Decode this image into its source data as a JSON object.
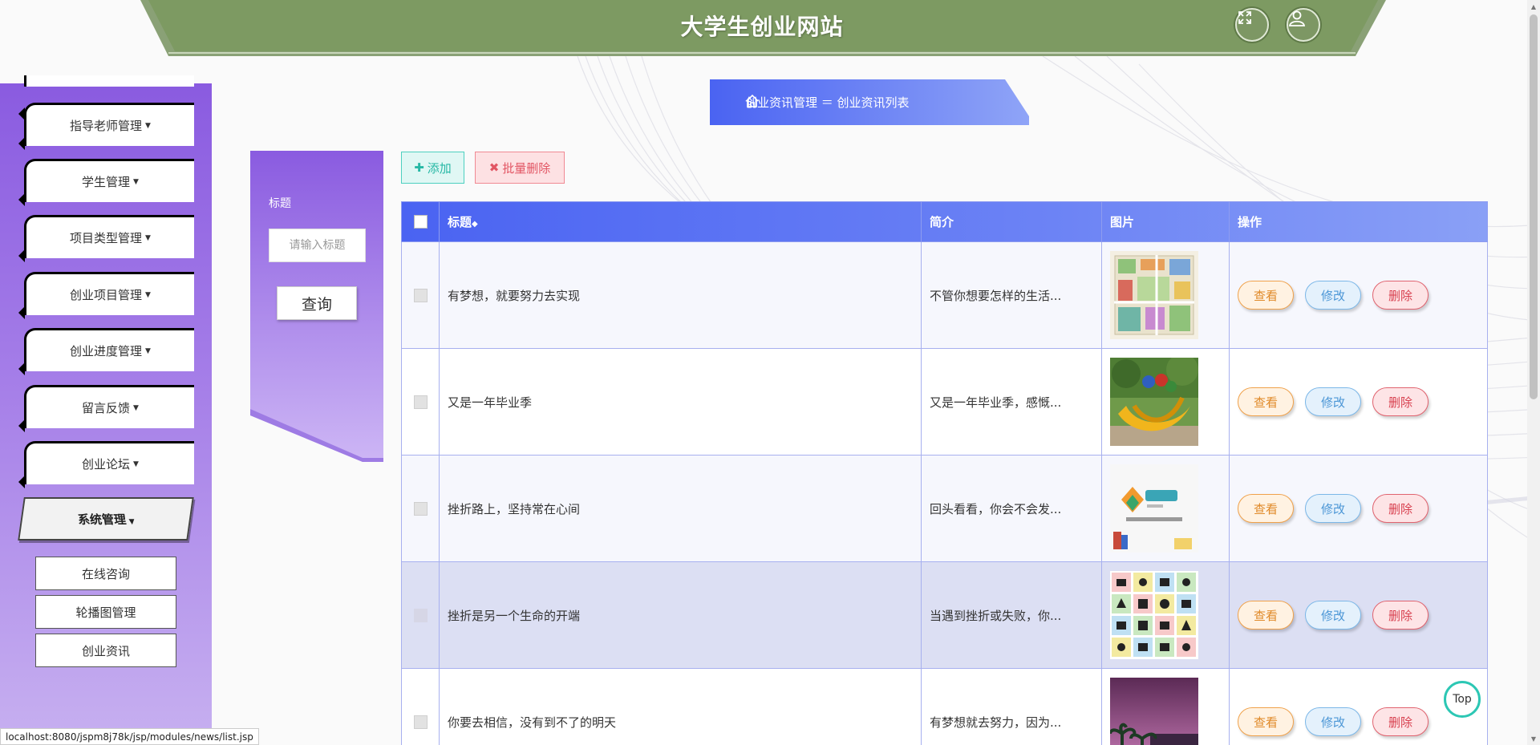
{
  "header": {
    "title": "大学生创业网站",
    "fullscreen_icon": "fullscreen-icon",
    "user_icon": "user-icon",
    "bg_color": "#7d9a62"
  },
  "sidebar": {
    "items": [
      {
        "label": "指导老师管理"
      },
      {
        "label": "学生管理"
      },
      {
        "label": "项目类型管理"
      },
      {
        "label": "创业项目管理"
      },
      {
        "label": "创业进度管理"
      },
      {
        "label": "留言反馈"
      },
      {
        "label": "创业论坛"
      },
      {
        "label": "系统管理"
      }
    ],
    "subitems": [
      {
        "label": "在线咨询"
      },
      {
        "label": "轮播图管理"
      },
      {
        "label": "创业资讯"
      }
    ]
  },
  "breadcrumb": {
    "home_icon": "home-icon",
    "text": "创业资讯管理 ＝ 创业资讯列表"
  },
  "search": {
    "label": "标题",
    "placeholder": "请输入标题",
    "button": "查询"
  },
  "actions": {
    "add": "添加",
    "batch_delete": "批量删除"
  },
  "table": {
    "columns": {
      "title": "标题",
      "intro": "简介",
      "image": "图片",
      "ops": "操作"
    },
    "rows": [
      {
        "title": "有梦想，就要努力去实现",
        "intro": "不管你想要怎样的生活...",
        "image": "map-illustration"
      },
      {
        "title": "又是一年毕业季",
        "intro": "又是一年毕业季，感慨...",
        "image": "sculpture-photo"
      },
      {
        "title": "挫折路上，坚持常在心间",
        "intro": "回头看看，你会不会发...",
        "image": "xuexi-logo"
      },
      {
        "title": "挫折是另一个生命的开端",
        "intro": "当遇到挫折或失败，你...",
        "image": "icon-grid"
      },
      {
        "title": "你要去相信，没有到不了的明天",
        "intro": "有梦想就去努力，因为...",
        "image": "campus-photo"
      }
    ],
    "ops": {
      "view": "查看",
      "edit": "修改",
      "delete": "删除"
    }
  },
  "top_button": "Top",
  "status_url": "localhost:8080/jspm8j78k/jsp/modules/news/list.jsp"
}
